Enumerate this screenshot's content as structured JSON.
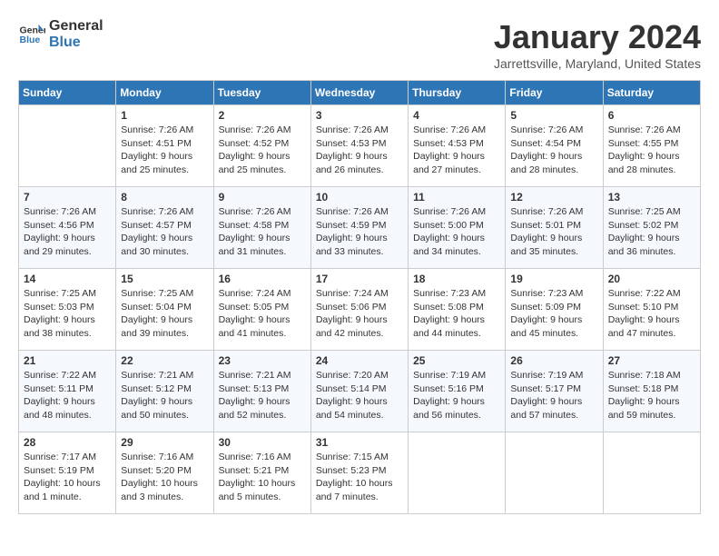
{
  "header": {
    "logo_line1": "General",
    "logo_line2": "Blue",
    "month_title": "January 2024",
    "location": "Jarrettsville, Maryland, United States"
  },
  "days_of_week": [
    "Sunday",
    "Monday",
    "Tuesday",
    "Wednesday",
    "Thursday",
    "Friday",
    "Saturday"
  ],
  "weeks": [
    [
      {
        "day": "",
        "sunrise": "",
        "sunset": "",
        "daylight": ""
      },
      {
        "day": "1",
        "sunrise": "Sunrise: 7:26 AM",
        "sunset": "Sunset: 4:51 PM",
        "daylight": "Daylight: 9 hours and 25 minutes."
      },
      {
        "day": "2",
        "sunrise": "Sunrise: 7:26 AM",
        "sunset": "Sunset: 4:52 PM",
        "daylight": "Daylight: 9 hours and 25 minutes."
      },
      {
        "day": "3",
        "sunrise": "Sunrise: 7:26 AM",
        "sunset": "Sunset: 4:53 PM",
        "daylight": "Daylight: 9 hours and 26 minutes."
      },
      {
        "day": "4",
        "sunrise": "Sunrise: 7:26 AM",
        "sunset": "Sunset: 4:53 PM",
        "daylight": "Daylight: 9 hours and 27 minutes."
      },
      {
        "day": "5",
        "sunrise": "Sunrise: 7:26 AM",
        "sunset": "Sunset: 4:54 PM",
        "daylight": "Daylight: 9 hours and 28 minutes."
      },
      {
        "day": "6",
        "sunrise": "Sunrise: 7:26 AM",
        "sunset": "Sunset: 4:55 PM",
        "daylight": "Daylight: 9 hours and 28 minutes."
      }
    ],
    [
      {
        "day": "7",
        "sunrise": "Sunrise: 7:26 AM",
        "sunset": "Sunset: 4:56 PM",
        "daylight": "Daylight: 9 hours and 29 minutes."
      },
      {
        "day": "8",
        "sunrise": "Sunrise: 7:26 AM",
        "sunset": "Sunset: 4:57 PM",
        "daylight": "Daylight: 9 hours and 30 minutes."
      },
      {
        "day": "9",
        "sunrise": "Sunrise: 7:26 AM",
        "sunset": "Sunset: 4:58 PM",
        "daylight": "Daylight: 9 hours and 31 minutes."
      },
      {
        "day": "10",
        "sunrise": "Sunrise: 7:26 AM",
        "sunset": "Sunset: 4:59 PM",
        "daylight": "Daylight: 9 hours and 33 minutes."
      },
      {
        "day": "11",
        "sunrise": "Sunrise: 7:26 AM",
        "sunset": "Sunset: 5:00 PM",
        "daylight": "Daylight: 9 hours and 34 minutes."
      },
      {
        "day": "12",
        "sunrise": "Sunrise: 7:26 AM",
        "sunset": "Sunset: 5:01 PM",
        "daylight": "Daylight: 9 hours and 35 minutes."
      },
      {
        "day": "13",
        "sunrise": "Sunrise: 7:25 AM",
        "sunset": "Sunset: 5:02 PM",
        "daylight": "Daylight: 9 hours and 36 minutes."
      }
    ],
    [
      {
        "day": "14",
        "sunrise": "Sunrise: 7:25 AM",
        "sunset": "Sunset: 5:03 PM",
        "daylight": "Daylight: 9 hours and 38 minutes."
      },
      {
        "day": "15",
        "sunrise": "Sunrise: 7:25 AM",
        "sunset": "Sunset: 5:04 PM",
        "daylight": "Daylight: 9 hours and 39 minutes."
      },
      {
        "day": "16",
        "sunrise": "Sunrise: 7:24 AM",
        "sunset": "Sunset: 5:05 PM",
        "daylight": "Daylight: 9 hours and 41 minutes."
      },
      {
        "day": "17",
        "sunrise": "Sunrise: 7:24 AM",
        "sunset": "Sunset: 5:06 PM",
        "daylight": "Daylight: 9 hours and 42 minutes."
      },
      {
        "day": "18",
        "sunrise": "Sunrise: 7:23 AM",
        "sunset": "Sunset: 5:08 PM",
        "daylight": "Daylight: 9 hours and 44 minutes."
      },
      {
        "day": "19",
        "sunrise": "Sunrise: 7:23 AM",
        "sunset": "Sunset: 5:09 PM",
        "daylight": "Daylight: 9 hours and 45 minutes."
      },
      {
        "day": "20",
        "sunrise": "Sunrise: 7:22 AM",
        "sunset": "Sunset: 5:10 PM",
        "daylight": "Daylight: 9 hours and 47 minutes."
      }
    ],
    [
      {
        "day": "21",
        "sunrise": "Sunrise: 7:22 AM",
        "sunset": "Sunset: 5:11 PM",
        "daylight": "Daylight: 9 hours and 48 minutes."
      },
      {
        "day": "22",
        "sunrise": "Sunrise: 7:21 AM",
        "sunset": "Sunset: 5:12 PM",
        "daylight": "Daylight: 9 hours and 50 minutes."
      },
      {
        "day": "23",
        "sunrise": "Sunrise: 7:21 AM",
        "sunset": "Sunset: 5:13 PM",
        "daylight": "Daylight: 9 hours and 52 minutes."
      },
      {
        "day": "24",
        "sunrise": "Sunrise: 7:20 AM",
        "sunset": "Sunset: 5:14 PM",
        "daylight": "Daylight: 9 hours and 54 minutes."
      },
      {
        "day": "25",
        "sunrise": "Sunrise: 7:19 AM",
        "sunset": "Sunset: 5:16 PM",
        "daylight": "Daylight: 9 hours and 56 minutes."
      },
      {
        "day": "26",
        "sunrise": "Sunrise: 7:19 AM",
        "sunset": "Sunset: 5:17 PM",
        "daylight": "Daylight: 9 hours and 57 minutes."
      },
      {
        "day": "27",
        "sunrise": "Sunrise: 7:18 AM",
        "sunset": "Sunset: 5:18 PM",
        "daylight": "Daylight: 9 hours and 59 minutes."
      }
    ],
    [
      {
        "day": "28",
        "sunrise": "Sunrise: 7:17 AM",
        "sunset": "Sunset: 5:19 PM",
        "daylight": "Daylight: 10 hours and 1 minute."
      },
      {
        "day": "29",
        "sunrise": "Sunrise: 7:16 AM",
        "sunset": "Sunset: 5:20 PM",
        "daylight": "Daylight: 10 hours and 3 minutes."
      },
      {
        "day": "30",
        "sunrise": "Sunrise: 7:16 AM",
        "sunset": "Sunset: 5:21 PM",
        "daylight": "Daylight: 10 hours and 5 minutes."
      },
      {
        "day": "31",
        "sunrise": "Sunrise: 7:15 AM",
        "sunset": "Sunset: 5:23 PM",
        "daylight": "Daylight: 10 hours and 7 minutes."
      },
      {
        "day": "",
        "sunrise": "",
        "sunset": "",
        "daylight": ""
      },
      {
        "day": "",
        "sunrise": "",
        "sunset": "",
        "daylight": ""
      },
      {
        "day": "",
        "sunrise": "",
        "sunset": "",
        "daylight": ""
      }
    ]
  ]
}
